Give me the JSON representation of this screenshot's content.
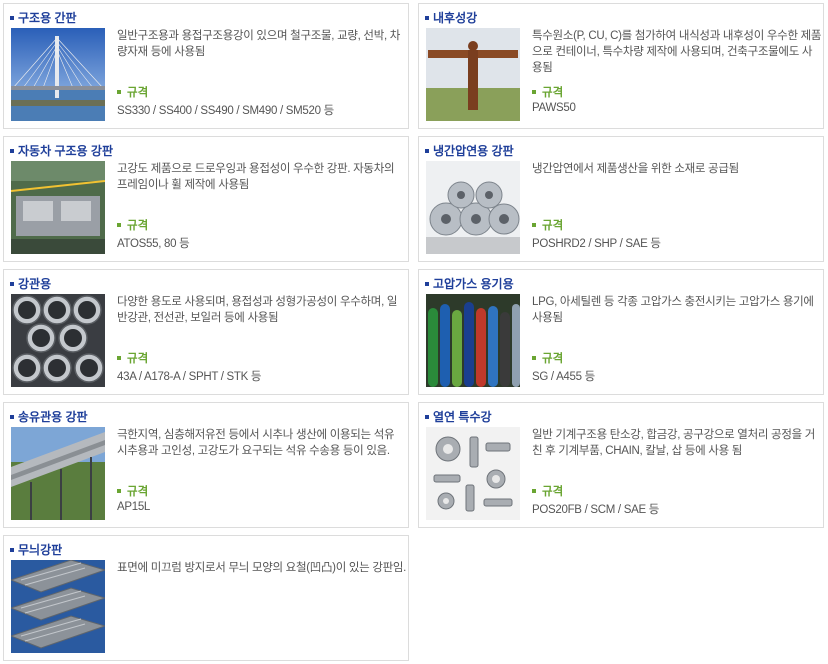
{
  "products": [
    {
      "title": "구조용 간판",
      "desc": "일반구조용과 용접구조용강이 있으며 철구조물, 교량, 선박, 차량자재 등에 사용됨",
      "spec_label": "규격",
      "spec_value": "SS330 / SS400 / SS490 / SM490 / SM520 등",
      "image": "bridge-photo"
    },
    {
      "title": "내후성강",
      "desc": "특수원소(P, CU, C)를 첨가하여 내식성과 내후성이 우수한 제품으로 컨테이너, 특수차량 제작에 사용되며, 건축구조물에도 사용됨",
      "spec_label": "규격",
      "spec_value": "PAWS50",
      "image": "angel-statue-photo"
    },
    {
      "title": "자동차 구조용 강판",
      "desc": "고강도 제품으로 드로우잉과 용접성이 우수한 강판. 자동차의 프레임이나 휠 제작에 사용됨",
      "spec_label": "규격",
      "spec_value": "ATOS55, 80 등",
      "image": "car-factory-photo"
    },
    {
      "title": "냉간압연용 강판",
      "desc": "냉간압연에서 제품생산을 위한 소재로 공급됨",
      "spec_label": "규격",
      "spec_value": "POSHRD2 / SHP / SAE 등",
      "image": "steel-coils-photo"
    },
    {
      "title": "강관용",
      "desc": "다양한 용도로 사용되며, 용접성과 성형가공성이 우수하며, 일반강관, 전선관, 보일러 등에 사용됨",
      "spec_label": "규격",
      "spec_value": "43A / A178-A / SPHT / STK 등",
      "image": "steel-pipes-photo"
    },
    {
      "title": "고압가스 용기용",
      "desc": "LPG, 아세틸렌 등 각종 고압가스 충전시키는 고압가스 용기에 사용됨",
      "spec_label": "규격",
      "spec_value": "SG / A455 등",
      "image": "gas-cylinders-photo"
    },
    {
      "title": "송유관용 강판",
      "desc": "극한지역, 심층해저유전 등에서 시추나 생산에 이용되는 석유 시추용과 고인성, 고강도가 요구되는 석유 수송용 등이 있음.",
      "spec_label": "규격",
      "spec_value": "AP15L",
      "image": "pipeline-photo"
    },
    {
      "title": "열연 특수강",
      "desc": "일반 기계구조용 탄소강, 합금강, 공구강으로 열처리 공정을 거친 후 기계부품, CHAIN, 칼날, 삽 등에 사용 됨",
      "spec_label": "규격",
      "spec_value": "POS20FB / SCM / SAE 등",
      "image": "machine-parts-photo"
    },
    {
      "title": "무늬강판",
      "desc": "표면에 미끄럼 방지로서 무늬 모양의 요철(凹凸)이 있는 강판임.",
      "spec_label": "",
      "spec_value": "",
      "image": "checker-plate-stairs-photo"
    }
  ],
  "colors": {
    "title": "#1f3f9a",
    "spec": "#6aa532",
    "text": "#555555",
    "border": "#dcdcdc"
  }
}
